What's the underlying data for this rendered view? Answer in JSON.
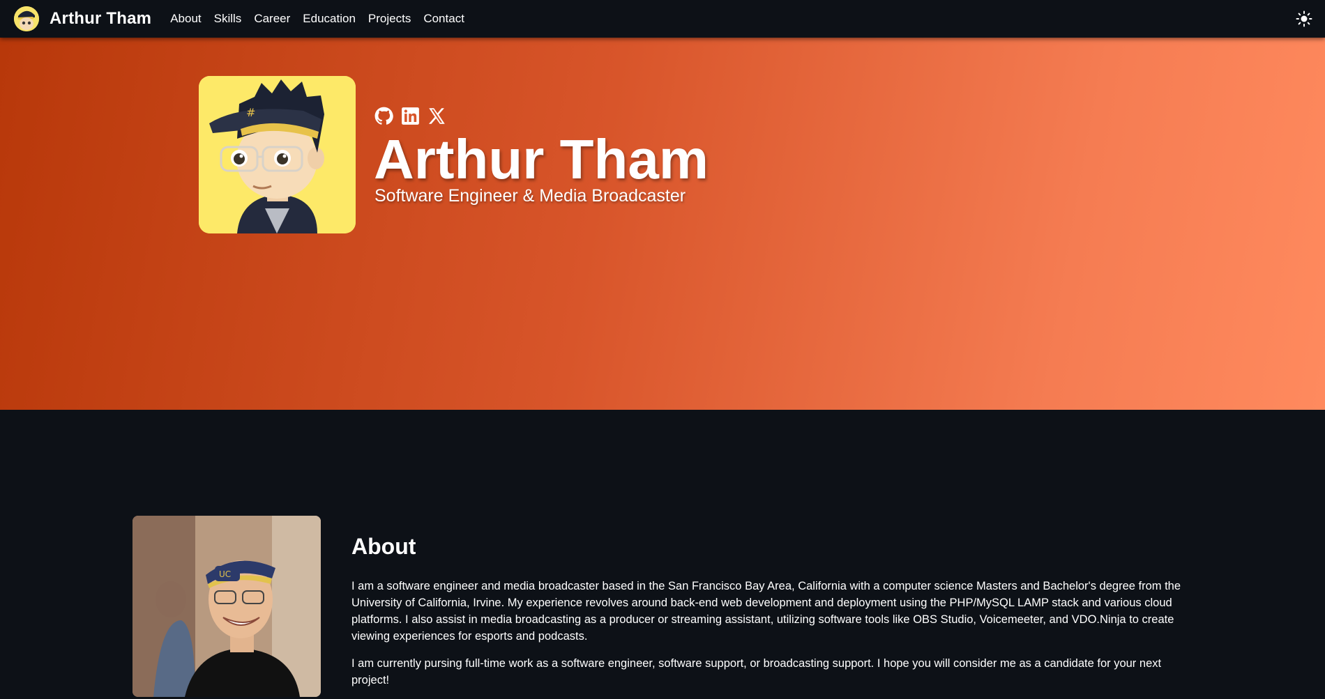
{
  "brand": {
    "name": "Arthur Tham",
    "logo": "cartoon-avatar-icon"
  },
  "nav": {
    "links": [
      "About",
      "Skills",
      "Career",
      "Education",
      "Projects",
      "Contact"
    ],
    "theme_toggle": "sun-icon"
  },
  "hero": {
    "name": "Arthur Tham",
    "subtitle": "Software Engineer & Media Broadcaster",
    "avatar": "cartoon-avatar",
    "socials": [
      "github-icon",
      "linkedin-icon",
      "x-icon"
    ],
    "gradient": [
      "#b8380a",
      "#ff8a5e"
    ]
  },
  "about": {
    "title": "About",
    "paragraphs": [
      "I am a software engineer and media broadcaster based in the San Francisco Bay Area, California with a computer science Masters and Bachelor's degree from the University of California, Irvine. My experience revolves around back-end web development and deployment using the PHP/MySQL LAMP stack and various cloud platforms. I also assist in media broadcasting as a producer or streaming assistant, utilizing software tools like OBS Studio, Voicemeeter, and VDO.Ninja to create viewing experiences for esports and podcasts.",
      "I am currently pursing full-time work as a software engineer, software support, or broadcasting support. I hope you will consider me as a candidate for your next project!"
    ]
  },
  "colors": {
    "background": "#0d1117",
    "navbar": "#0d1117",
    "avatar_bg": "#fde968"
  }
}
